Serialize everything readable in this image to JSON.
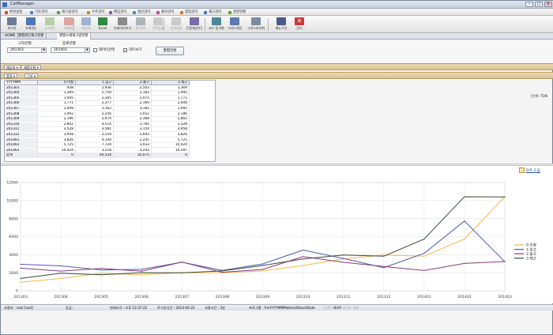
{
  "window": {
    "title": "CatManager"
  },
  "menu": [
    {
      "label": "환경설정",
      "color": "#d04a3a"
    },
    {
      "label": "기초관리",
      "color": "#4a7fc9"
    },
    {
      "label": "재고정관리",
      "color": "#4ca04a"
    },
    {
      "label": "수주관리",
      "color": "#c28b2a"
    },
    {
      "label": "매입관리",
      "color": "#7a56b8"
    },
    {
      "label": "생산관리",
      "color": "#2e9aa0"
    },
    {
      "label": "출하관리",
      "color": "#c24a8e"
    },
    {
      "label": "영업관리",
      "color": "#d07a2a"
    },
    {
      "label": "재고관리",
      "color": "#4a6ec9"
    },
    {
      "label": "경영현황",
      "color": "#6a9a2a"
    }
  ],
  "toolbar": [
    {
      "label": "보고언",
      "icon": "book-icon",
      "enabled": true
    },
    {
      "label": "조회(Q)",
      "icon": "search-icon",
      "enabled": true
    },
    {
      "label": "추가(A)",
      "icon": "add-icon",
      "enabled": false
    },
    {
      "label": "삭제(D)",
      "icon": "delete-icon",
      "enabled": false
    },
    {
      "label": "저장(S)",
      "icon": "save-icon",
      "enabled": false
    },
    {
      "label": "Excel",
      "icon": "excel-icon",
      "enabled": true
    },
    {
      "label": "인쇄미리보기",
      "icon": "preview-icon",
      "enabled": true
    },
    {
      "label": "출력(P)",
      "icon": "print-icon",
      "enabled": false
    },
    {
      "label": "선택일괄",
      "icon": "select-icon",
      "enabled": false
    },
    {
      "label": "전체일괄",
      "icon": "select-all-icon",
      "enabled": false
    },
    {
      "label": "단종계산(C)",
      "icon": "calc-icon",
      "enabled": true
    },
    {
      "label": "코드 동기화",
      "icon": "sync-icon",
      "enabled": true
    },
    {
      "label": "그리드저장",
      "icon": "grid-save-icon",
      "enabled": true
    },
    {
      "label": "그리드초기화",
      "icon": "grid-reset-icon",
      "enabled": true
    },
    {
      "label": "메뉴구성",
      "icon": "menu-config-icon",
      "enabled": true
    },
    {
      "label": "닫기",
      "icon": "close-icon",
      "enabled": true
    }
  ],
  "tabs": [
    {
      "label": "HOME"
    },
    {
      "label": "월별원단재고현황"
    },
    {
      "label": "월별소재재고량현황"
    }
  ],
  "filter": {
    "start_label": "시작년월",
    "end_label": "종료년월",
    "start_value": "201303",
    "end_value": "201403",
    "data_select": "데이터선택",
    "chart_view": "차트보기",
    "convert_button": "월별전환",
    "unit": "[단위: TON"
  },
  "band1": {
    "pill1": "매입처",
    "pill2": "제품유형"
  },
  "band2": {
    "pill1": "품명",
    "pill2": "구분"
  },
  "grid": {
    "headers": [
      "YYYYMM",
      "0.이월",
      "1.입고",
      "2.출고",
      "3.재고"
    ],
    "rows": [
      [
        "201303",
        "938",
        "2,936",
        "2,503",
        "1,369"
      ],
      [
        "201304",
        "1,369",
        "2,759",
        "2,183",
        "1,945"
      ],
      [
        "201305",
        "1,945",
        "2,305",
        "2,475",
        "1,771"
      ],
      [
        "201306",
        "1,771",
        "2,377",
        "2,160",
        "2,008"
      ],
      [
        "201307",
        "2,008",
        "3,162",
        "3,182",
        "1,992"
      ],
      [
        "201308",
        "1,992",
        "2,256",
        "2,052",
        "2,196"
      ],
      [
        "201309",
        "2,196",
        "2,974",
        "2,368",
        "2,802"
      ],
      [
        "201310",
        "2,802",
        "4,514",
        "3,785",
        "3,528"
      ],
      [
        "201311",
        "3,528",
        "3,581",
        "3,154",
        "3,958"
      ],
      [
        "201312",
        "3,958",
        "2,559",
        "2,693",
        "3,826"
      ],
      [
        "201401",
        "3,826",
        "4,144",
        "2,245",
        "5,725"
      ],
      [
        "201402",
        "5,725",
        "7,729",
        "3,033",
        "10,424"
      ],
      [
        "201403",
        "10,424",
        "3,218",
        "3,242",
        "10,397"
      ]
    ],
    "total": [
      "합계",
      "0",
      "44,534",
      "35,075",
      "0"
    ]
  },
  "chart_link": "차트 도움",
  "chart_data": {
    "type": "line",
    "x": [
      "201303",
      "201304",
      "201305",
      "201306",
      "201307",
      "201308",
      "201309",
      "201310",
      "201311",
      "201312",
      "201401",
      "201402",
      "201403"
    ],
    "ylim": [
      0,
      12000
    ],
    "yticks": [
      0,
      2000,
      4000,
      6000,
      8000,
      10000,
      12000
    ],
    "grid": true,
    "legend_position": "right",
    "series": [
      {
        "name": "0.이월",
        "color": "#f0b84a",
        "values": [
          938,
          1369,
          1945,
          1771,
          2008,
          1992,
          2196,
          2802,
          3528,
          3958,
          3826,
          5725,
          10424
        ]
      },
      {
        "name": "1.입고",
        "color": "#4a5ea8",
        "values": [
          2936,
          2759,
          2305,
          2377,
          3162,
          2256,
          2974,
          4514,
          3581,
          2559,
          4144,
          7729,
          3218
        ]
      },
      {
        "name": "2.출고",
        "color": "#8a3a78",
        "values": [
          2503,
          2183,
          2475,
          2160,
          3182,
          2052,
          2368,
          3785,
          3154,
          2693,
          2245,
          3033,
          3242
        ]
      },
      {
        "name": "3.재고",
        "color": "#3c4a3c",
        "values": [
          1369,
          1945,
          1771,
          2008,
          1992,
          2196,
          2802,
          3528,
          3958,
          3826,
          5725,
          10424,
          10397
        ]
      }
    ]
  },
  "status": {
    "user": "사용자 : root [root]",
    "level": "등급 :",
    "time": "현재시각 : 오후 12:37:22",
    "login": "로그인시간 : 2014-04-22",
    "session": "사용시간 : 2분",
    "program": "프로그램 : frmYYYYMMMaterialStockState",
    "caps": "CAPS",
    "num": "NUM",
    "scrl": "SCRL",
    "ins": "INS"
  }
}
